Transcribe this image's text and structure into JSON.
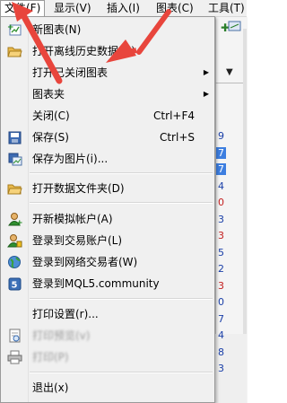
{
  "menubar": {
    "items": [
      "文件(F)",
      "显示(V)",
      "插入(I)",
      "图表(C)",
      "工具(T)"
    ]
  },
  "file_menu": {
    "items": [
      {
        "label": "新图表(N)",
        "icon": "new-chart-icon"
      },
      {
        "label": "打开离线历史数据(O)",
        "icon": "open-folder-icon"
      },
      {
        "label": "打开已关闭图表",
        "has_submenu": true
      },
      {
        "label": "图表夹",
        "has_submenu": true
      },
      {
        "label": "关闭(C)",
        "shortcut": "Ctrl+F4"
      },
      {
        "label": "保存(S)",
        "shortcut": "Ctrl+S",
        "icon": "save-icon"
      },
      {
        "label": "保存为图片(i)...",
        "icon": "save-picture-icon"
      },
      {
        "label": "打开数据文件夹(D)",
        "icon": "data-folder-icon"
      },
      {
        "label": "开新模拟帐户(A)",
        "icon": "add-account-icon"
      },
      {
        "label": "登录到交易账户(L)",
        "icon": "login-account-icon"
      },
      {
        "label": "登录到网络交易者(W)",
        "icon": "web-trader-icon"
      },
      {
        "label": "登录到MQL5.community",
        "icon": "mql5-icon"
      },
      {
        "label": "打印设置(r)...",
        "icon": "print-setup-icon"
      },
      {
        "label": "打印预览(v)",
        "icon": "print-preview-icon"
      },
      {
        "label": "打印(P)",
        "icon": "printer-icon"
      },
      {
        "label": "退出(x)"
      }
    ]
  },
  "background": {
    "right_numbers": [
      "9",
      "7",
      "7",
      "4",
      "0",
      "3",
      "3",
      "5",
      "2",
      "3",
      "0",
      "7",
      "4",
      "8",
      "3"
    ],
    "right_numbers_colors": [
      "#1a3fa8",
      "#ffffff",
      "#ffffff",
      "#1a3fa8",
      "#c42020",
      "#1a3fa8",
      "#c42020",
      "#1a3fa8",
      "#1a3fa8",
      "#c42020",
      "#1a3fa8",
      "#1a3fa8",
      "#1a3fa8",
      "#1a3fa8",
      "#1a3fa8"
    ],
    "right_highlight_rows": [
      1,
      2
    ]
  },
  "colors": {
    "menu_bg": "#f0f0f0",
    "menu_border": "#9a9a9a",
    "annotation_arrow": "#e8453c"
  }
}
